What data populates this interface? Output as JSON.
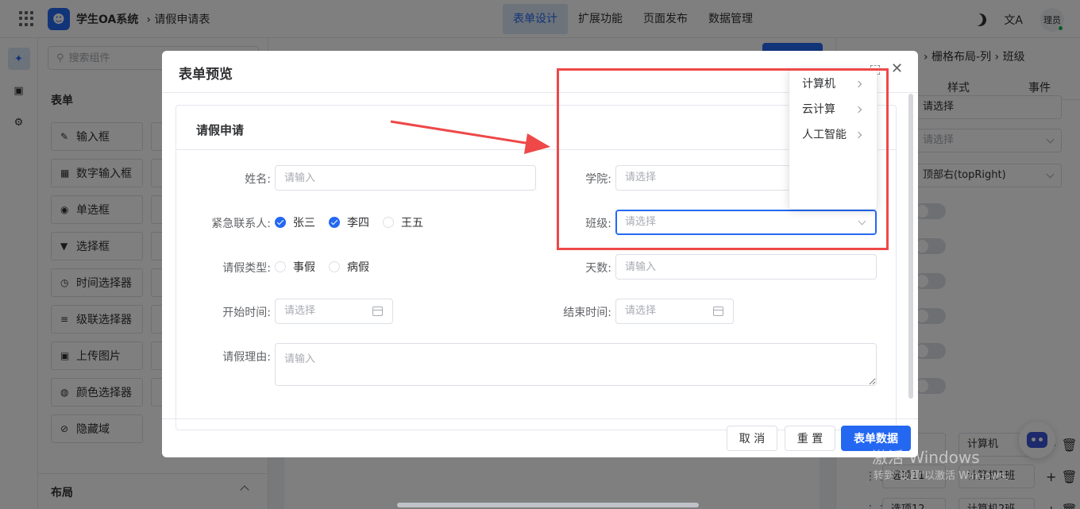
{
  "header": {
    "app_title": "学生OA系统",
    "breadcrumb": "› 请假申请表",
    "nav": [
      "表单设计",
      "扩展功能",
      "页面发布",
      "数据管理"
    ],
    "active_nav": "表单设计",
    "translate_icon": "文A",
    "user": "理员"
  },
  "sidebar": {
    "search_placeholder": "搜索组件",
    "section_form": "表单",
    "components": [
      "输入框",
      "数字输入框",
      "单选框",
      "选择框",
      "时间选择器",
      "级联选择器",
      "上传图片",
      "颜色选择器",
      "隐藏域"
    ],
    "section_layout": "布局"
  },
  "right_panel": {
    "breadcrumb": "› 栅格布局-列 › 班级",
    "tabs": [
      "样式",
      "事件"
    ],
    "fields": [
      "请选择",
      "请选择",
      "顶部右(topRight)"
    ],
    "options": [
      {
        "label": "",
        "value": "计算机"
      },
      {
        "label": "选项11",
        "value": "计算机1班"
      },
      {
        "label": "选项12",
        "value": "计算机2班"
      }
    ]
  },
  "watermark": {
    "line1": "激活 Windows",
    "line2": "转到\"设置\"以激活 Windows。"
  },
  "modal": {
    "title": "表单预览",
    "card_title": "请假申请",
    "fields": {
      "name": {
        "label": "姓名:",
        "placeholder": "请输入"
      },
      "contact": {
        "label": "紧急联系人:",
        "options": [
          {
            "text": "张三",
            "checked": true
          },
          {
            "text": "李四",
            "checked": true
          },
          {
            "text": "王五",
            "checked": false
          }
        ]
      },
      "leave_type": {
        "label": "请假类型:",
        "options": [
          "事假",
          "病假"
        ]
      },
      "start": {
        "label": "开始时间:",
        "placeholder": "请选择"
      },
      "reason": {
        "label": "请假理由:",
        "placeholder": "请输入"
      },
      "college": {
        "label": "学院:",
        "placeholder": "请选择"
      },
      "class": {
        "label": "班级:",
        "placeholder": "请选择"
      },
      "days": {
        "label": "天数:",
        "placeholder": "请输入"
      },
      "end": {
        "label": "结束时间:",
        "placeholder": "请选择"
      }
    },
    "buttons": {
      "cancel": "取 消",
      "reset": "重 置",
      "data": "表单数据"
    }
  },
  "cascader_options": [
    "计算机",
    "云计算",
    "人工智能"
  ],
  "colors": {
    "primary": "#2468f2",
    "annotation": "#ee4848"
  }
}
